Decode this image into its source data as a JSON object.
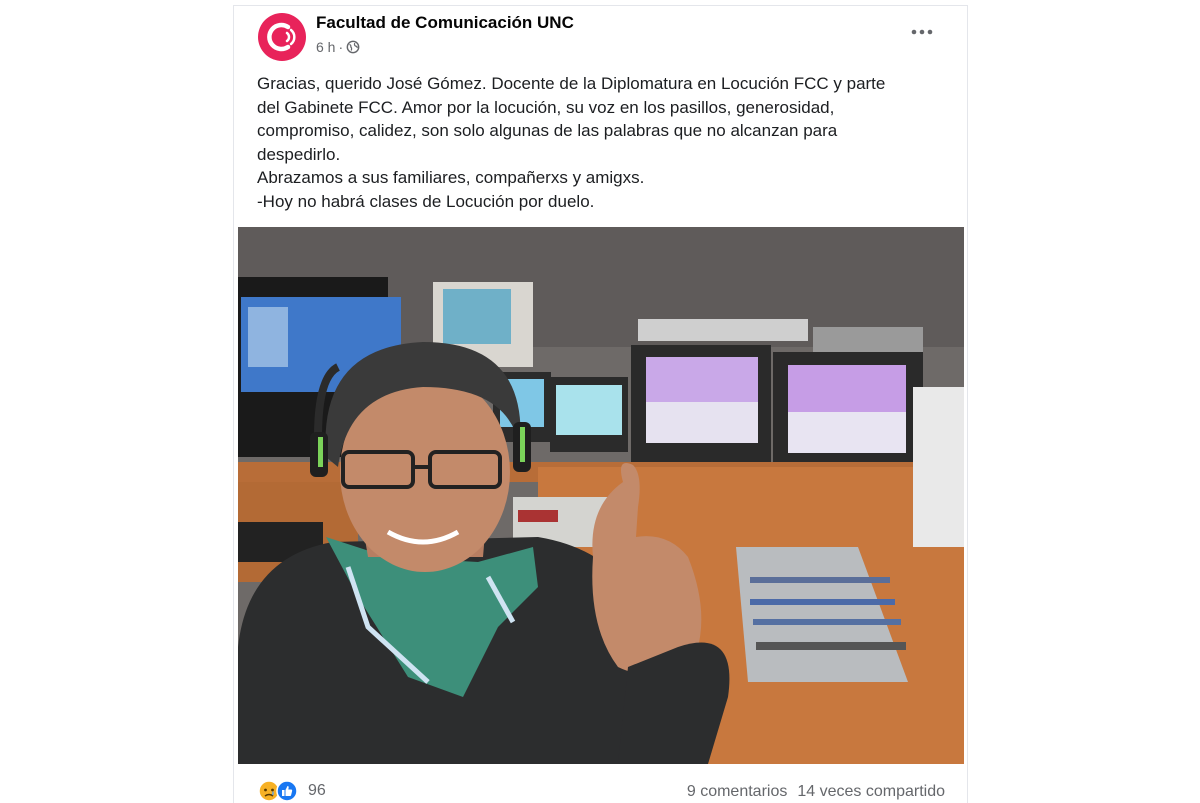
{
  "post": {
    "page_name": "Facultad de Comunicación UNC",
    "time": "6 h",
    "separator": "·",
    "privacy_icon": "globe-icon",
    "more_icon": "more-horizontal-icon",
    "text_lines": [
      "Gracias, querido José Gómez. Docente de la Diplomatura en Locución FCC y parte",
      "del Gabinete FCC. Amor por la locución, su voz en los pasillos, generosidad,",
      "compromiso, calidez, son solo algunas de las palabras que no alcanzan para",
      "despedirlo.",
      "Abrazamos a sus familiares, compañerxs y amigxs.",
      "-Hoy no habrá clases de Locución por duelo."
    ]
  },
  "engagement": {
    "reaction_icons": [
      "sad-reaction-icon",
      "like-reaction-icon"
    ],
    "reaction_count": "96",
    "comments": "9 comentarios",
    "shares": "14 veces compartido"
  },
  "colors": {
    "brand": "#e8235a",
    "like_blue": "#1877f2",
    "sad_yellow": "#f7b125",
    "text": "#1c1e21",
    "muted": "#65676b"
  }
}
